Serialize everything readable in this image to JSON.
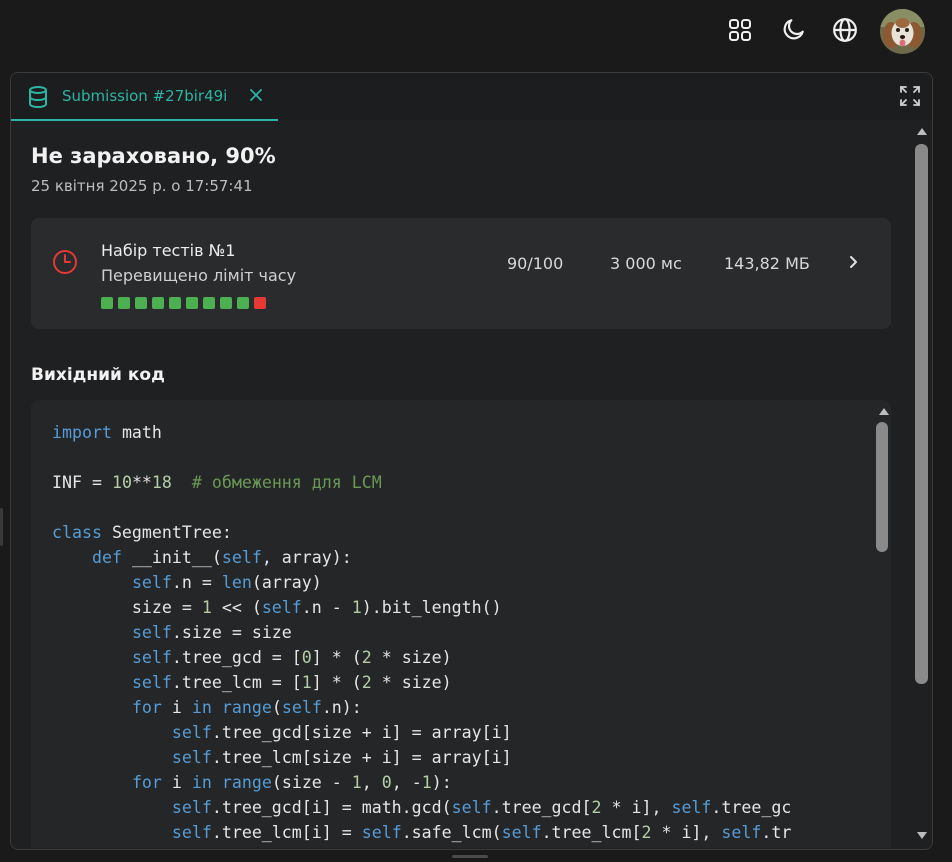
{
  "topbar": {
    "icons": [
      "apps-grid-icon",
      "moon-icon",
      "globe-icon"
    ],
    "avatar": "dog-avatar"
  },
  "tab": {
    "title": "Submission #27bir49i",
    "icon": "database-icon",
    "accent": "#2bb5a2"
  },
  "submission": {
    "status": "Не зараховано, 90%",
    "date": "25 квітня 2025 р. о 17:57:41"
  },
  "testset": {
    "name": "Набір тестів №1",
    "verdict": "Перевищено ліміт часу",
    "score": "90/100",
    "time": "3 000 мс",
    "memory": "143,82 МБ",
    "results": [
      "passed",
      "passed",
      "passed",
      "passed",
      "passed",
      "passed",
      "passed",
      "passed",
      "passed",
      "failed"
    ],
    "colors": {
      "passed": "#4caf50",
      "failed": "#e53935",
      "clock": "#e53935"
    }
  },
  "source": {
    "heading": "Вихідний код",
    "lines": [
      [
        [
          "kw",
          "import"
        ],
        [
          "t",
          " math"
        ]
      ],
      [],
      [
        [
          "t",
          "INF = "
        ],
        [
          "num",
          "10"
        ],
        [
          "t",
          "**"
        ],
        [
          "num",
          "18"
        ],
        [
          "t",
          "  "
        ],
        [
          "cmt",
          "# обмеження для LCM"
        ]
      ],
      [],
      [
        [
          "kw",
          "class"
        ],
        [
          "t",
          " SegmentTree:"
        ]
      ],
      [
        [
          "t",
          "    "
        ],
        [
          "kw",
          "def"
        ],
        [
          "t",
          " __init__("
        ],
        [
          "kw",
          "self"
        ],
        [
          "t",
          ", array):"
        ]
      ],
      [
        [
          "t",
          "        "
        ],
        [
          "kw",
          "self"
        ],
        [
          "t",
          ".n = "
        ],
        [
          "kw",
          "len"
        ],
        [
          "t",
          "(array)"
        ]
      ],
      [
        [
          "t",
          "        size = "
        ],
        [
          "num",
          "1"
        ],
        [
          "t",
          " << ("
        ],
        [
          "kw",
          "self"
        ],
        [
          "t",
          ".n - "
        ],
        [
          "num",
          "1"
        ],
        [
          "t",
          ").bit_length()"
        ]
      ],
      [
        [
          "t",
          "        "
        ],
        [
          "kw",
          "self"
        ],
        [
          "t",
          ".size = size"
        ]
      ],
      [
        [
          "t",
          "        "
        ],
        [
          "kw",
          "self"
        ],
        [
          "t",
          ".tree_gcd = ["
        ],
        [
          "num",
          "0"
        ],
        [
          "t",
          "] * ("
        ],
        [
          "num",
          "2"
        ],
        [
          "t",
          " * size)"
        ]
      ],
      [
        [
          "t",
          "        "
        ],
        [
          "kw",
          "self"
        ],
        [
          "t",
          ".tree_lcm = ["
        ],
        [
          "num",
          "1"
        ],
        [
          "t",
          "] * ("
        ],
        [
          "num",
          "2"
        ],
        [
          "t",
          " * size)"
        ]
      ],
      [
        [
          "t",
          "        "
        ],
        [
          "kw",
          "for"
        ],
        [
          "t",
          " i "
        ],
        [
          "kw",
          "in"
        ],
        [
          "t",
          " "
        ],
        [
          "kw",
          "range"
        ],
        [
          "t",
          "("
        ],
        [
          "kw",
          "self"
        ],
        [
          "t",
          ".n):"
        ]
      ],
      [
        [
          "t",
          "            "
        ],
        [
          "kw",
          "self"
        ],
        [
          "t",
          ".tree_gcd[size + i] = array[i]"
        ]
      ],
      [
        [
          "t",
          "            "
        ],
        [
          "kw",
          "self"
        ],
        [
          "t",
          ".tree_lcm[size + i] = array[i]"
        ]
      ],
      [
        [
          "t",
          "        "
        ],
        [
          "kw",
          "for"
        ],
        [
          "t",
          " i "
        ],
        [
          "kw",
          "in"
        ],
        [
          "t",
          " "
        ],
        [
          "kw",
          "range"
        ],
        [
          "t",
          "(size - "
        ],
        [
          "num",
          "1"
        ],
        [
          "t",
          ", "
        ],
        [
          "num",
          "0"
        ],
        [
          "t",
          ", -"
        ],
        [
          "num",
          "1"
        ],
        [
          "t",
          "):"
        ]
      ],
      [
        [
          "t",
          "            "
        ],
        [
          "kw",
          "self"
        ],
        [
          "t",
          ".tree_gcd[i] = math.gcd("
        ],
        [
          "kw",
          "self"
        ],
        [
          "t",
          ".tree_gcd["
        ],
        [
          "num",
          "2"
        ],
        [
          "t",
          " * i], "
        ],
        [
          "kw",
          "self"
        ],
        [
          "t",
          ".tree_gc"
        ]
      ],
      [
        [
          "t",
          "            "
        ],
        [
          "kw",
          "self"
        ],
        [
          "t",
          ".tree_lcm[i] = "
        ],
        [
          "kw",
          "self"
        ],
        [
          "t",
          ".safe_lcm("
        ],
        [
          "kw",
          "self"
        ],
        [
          "t",
          ".tree_lcm["
        ],
        [
          "num",
          "2"
        ],
        [
          "t",
          " * i], "
        ],
        [
          "kw",
          "self"
        ],
        [
          "t",
          ".tr"
        ]
      ]
    ]
  }
}
